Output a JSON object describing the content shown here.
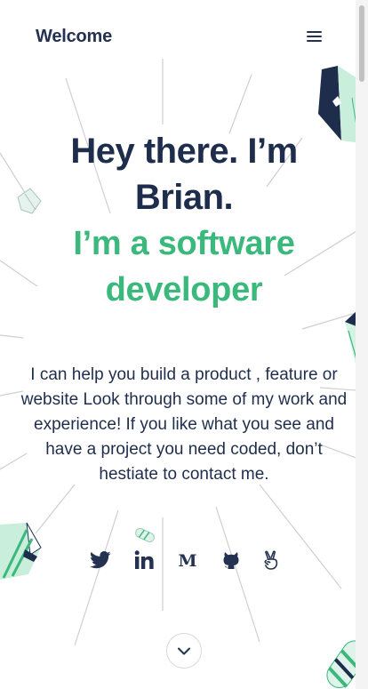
{
  "header": {
    "brand": "Welcome",
    "menu_icon": "hamburger-icon"
  },
  "hero": {
    "greeting": "Hey there. I’m Brian.",
    "role": "I’m a software developer",
    "description": "I can help you build a product , feature or website Look through some of my work and experience! If you like what you see and have a project you need coded, don’t hestiate to contact me."
  },
  "social": [
    {
      "name": "twitter-icon"
    },
    {
      "name": "linkedin-icon"
    },
    {
      "name": "medium-icon"
    },
    {
      "name": "github-icon"
    },
    {
      "name": "angellist-icon"
    }
  ],
  "scroll_icon": "chevron-down-icon",
  "colors": {
    "navy": "#1f2d4d",
    "accent_green": "#3bb87c",
    "line_gray": "#c8c8c8"
  }
}
